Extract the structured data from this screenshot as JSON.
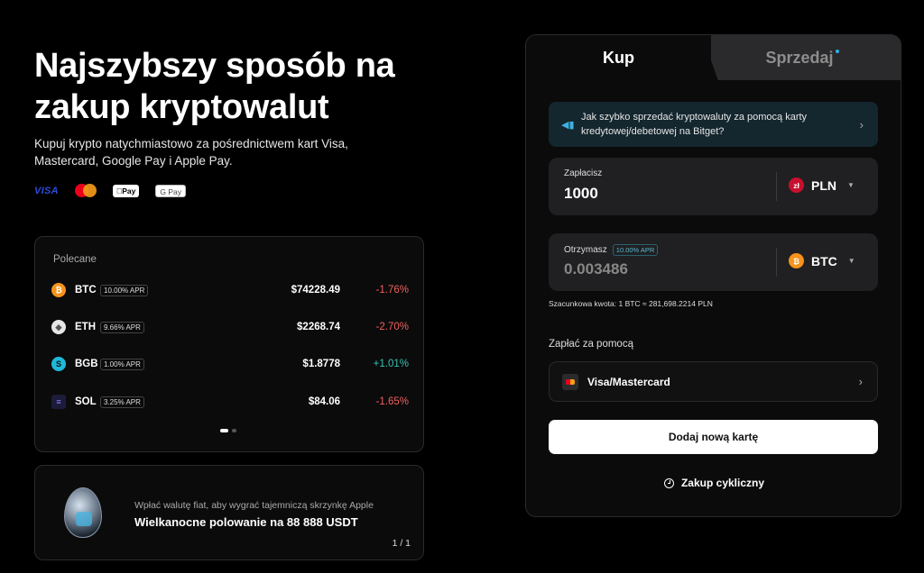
{
  "hero": {
    "title": "Najszybszy sposób na zakup kryptowalut",
    "subtitle": "Kupuj krypto natychmiastowo za pośrednictwem kart Visa, Mastercard, Google Pay i Apple Pay.",
    "logos": {
      "visa": "VISA",
      "apple_pay": "Pay",
      "google_pay": "G Pay"
    }
  },
  "featured": {
    "title": "Polecane",
    "coins": [
      {
        "symbol": "BTC",
        "apr": "10.00% APR",
        "price": "$74228.49",
        "change": "-1.76%",
        "direction": "down",
        "icon": "bitcoin-icon",
        "color": "#f7931a"
      },
      {
        "symbol": "ETH",
        "apr": "9.66% APR",
        "price": "$2268.74",
        "change": "-2.70%",
        "direction": "down",
        "icon": "ethereum-icon",
        "color": "#e6e6e6"
      },
      {
        "symbol": "BGB",
        "apr": "1.00% APR",
        "price": "$1.8778",
        "change": "+1.01%",
        "direction": "up",
        "icon": "bitget-icon",
        "color": "#1fb8d8"
      },
      {
        "symbol": "SOL",
        "apr": "3.25% APR",
        "price": "$84.06",
        "change": "-1.65%",
        "direction": "down",
        "icon": "solana-icon",
        "color": "#1c1c3a"
      }
    ]
  },
  "promo": {
    "subtitle": "Wpłać walutę fiat, aby wygrać tajemniczą skrzynkę Apple",
    "title": "Wielkanocne polowanie na 88 888 USDT",
    "page": "1 / 1"
  },
  "trade": {
    "tabs": {
      "buy": "Kup",
      "sell": "Sprzedaj"
    },
    "info": "Jak szybko sprzedać kryptowaluty za pomocą karty kredytowej/debetowej na Bitget?",
    "pay": {
      "label": "Zapłacisz",
      "value": "1000",
      "currency": "PLN",
      "currency_symbol": "zł"
    },
    "receive": {
      "label": "Otrzymasz",
      "apr": "10.00% APR",
      "value": "0.003486",
      "currency": "BTC",
      "currency_symbol": "₿"
    },
    "estimate": "Szacunkowa kwota: 1 BTC ≈ 281,698.2214 PLN",
    "pay_with_label": "Zapłać za pomocą",
    "method": "Visa/Mastercard",
    "add_card": "Dodaj nową kartę",
    "recurring": "Zakup cykliczny"
  },
  "colors": {
    "negative": "#f0605d",
    "positive": "#38c2b5",
    "accent": "#2bb3e8"
  }
}
